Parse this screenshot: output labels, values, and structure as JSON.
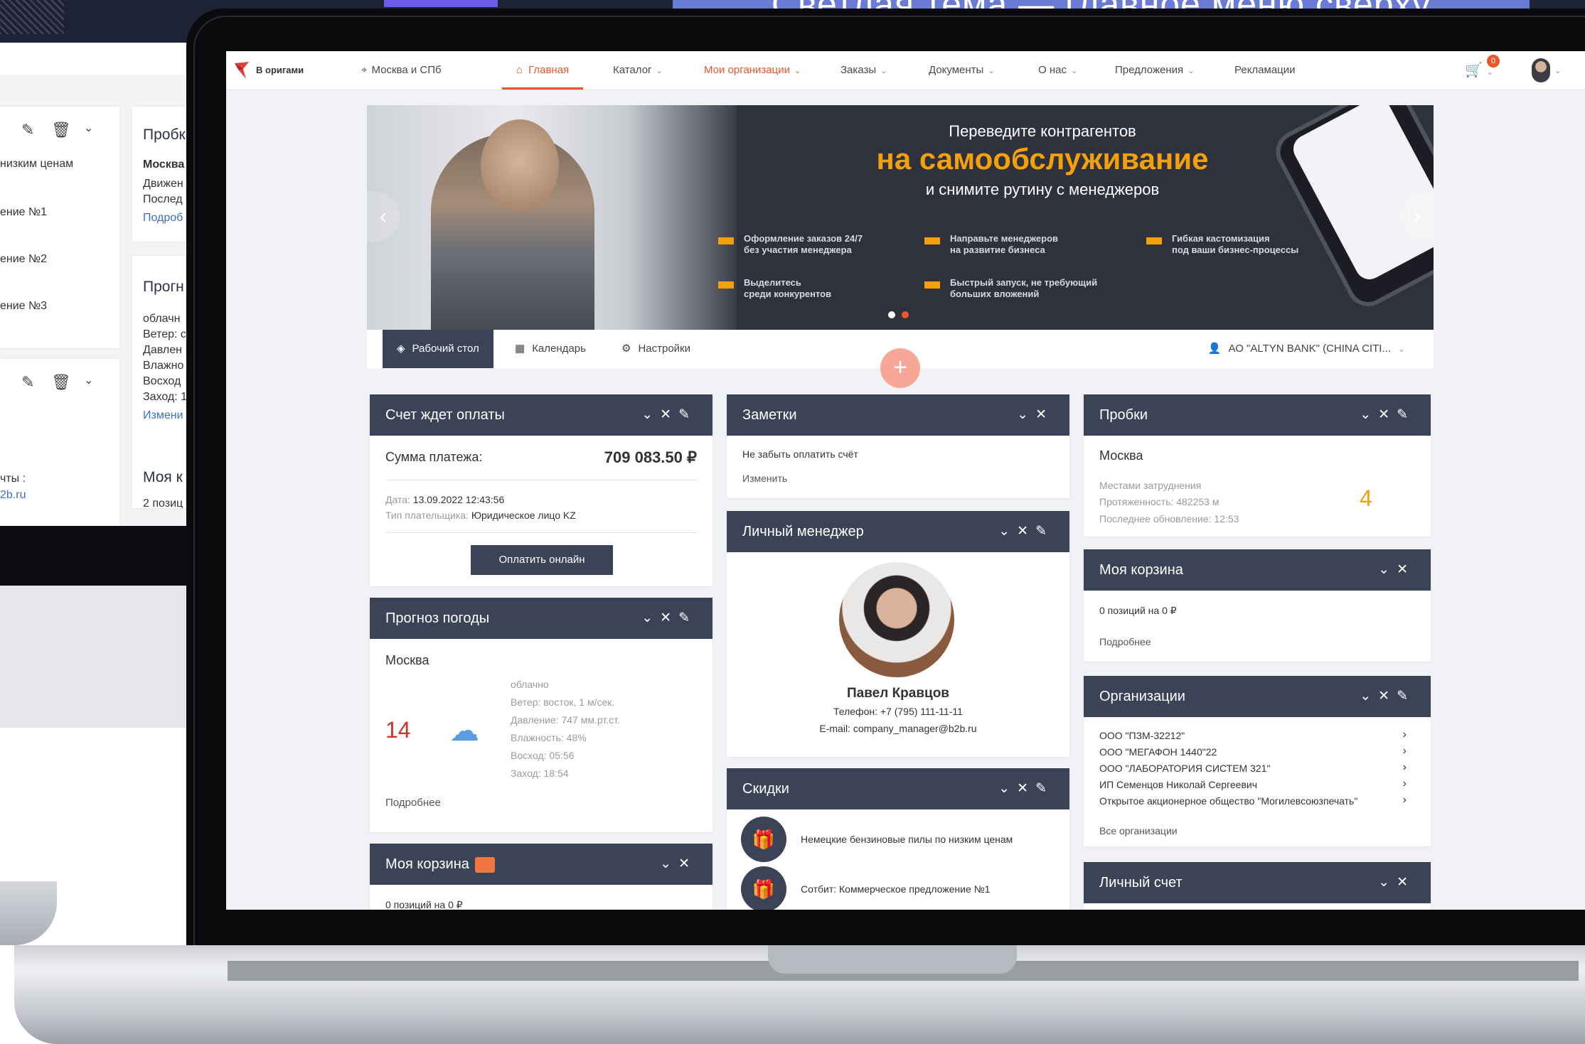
{
  "theme_banner": {
    "text": "Светлая тема — главное меню сверху"
  },
  "nav": {
    "logo": "В оригами",
    "location": "Москва и СПб",
    "items": [
      {
        "label": "Главная"
      },
      {
        "label": "Каталог"
      },
      {
        "label": "Мои организации"
      },
      {
        "label": "Заказы"
      },
      {
        "label": "Документы"
      },
      {
        "label": "О нас"
      },
      {
        "label": "Предложения"
      },
      {
        "label": "Рекламации"
      }
    ],
    "cart_count": "0"
  },
  "hero": {
    "line1": "Переведите контрагентов",
    "line2": "на самообслуживание",
    "line3": "и снимите рутину с менеджеров",
    "features": [
      "Оформление заказов 24/7\nбез участия менеджера",
      "Направьте менеджеров\nна развитие бизнеса",
      "Гибкая кастомизация\nпод ваши бизнес-процессы",
      "Выделитесь\nсреди конкурентов",
      "Быстрый запуск, не требующий\nбольших вложений"
    ]
  },
  "tabs": {
    "desktop": "Рабочий стол",
    "calendar": "Календарь",
    "settings": "Настройки",
    "organization": "АО \"ALTYN BANK\" (CHINA CITI..."
  },
  "invoice": {
    "title": "Счет ждет оплаты",
    "amount_label": "Сумма платежа:",
    "amount": "709 083.50 ₽",
    "date_label": "Дата:",
    "date": "13.09.2022 12:43:56",
    "payer_label": "Тип плательщика:",
    "payer": "Юридическое лицо KZ",
    "pay_button": "Оплатить онлайн"
  },
  "notes": {
    "title": "Заметки",
    "text": "Не забыть оплатить счёт",
    "edit": "Изменить"
  },
  "traffic": {
    "title": "Пробки",
    "city": "Москва",
    "status": "Местами затруднения",
    "length": "Протяженность: 482253 м",
    "updated": "Последнее обновление: 12:53",
    "score": "4"
  },
  "weather": {
    "title": "Прогноз погоды",
    "city": "Москва",
    "temp": "14",
    "details": [
      "облачно",
      "Ветер: восток, 1 м/сек.",
      "Давление: 747 мм.рт.ст.",
      "Влажность: 48%",
      "Восход: 05:56",
      "Заход: 18:54"
    ],
    "more": "Подробнее"
  },
  "manager": {
    "title": "Личный менеджер",
    "name": "Павел Кравцов",
    "phone": "Телефон: +7 (795) 111-11-11",
    "email": "E-mail: company_manager@b2b.ru"
  },
  "cart_right": {
    "title": "Моя корзина",
    "text": "0 позиций на 0 ₽",
    "more": "Подробнее"
  },
  "orgs": {
    "title": "Организации",
    "items": [
      "ООО \"ПЗМ-32212\"",
      "ООО \"МЕГАФОН 1440\"22",
      "ООО \"ЛАБОРАТОРИЯ СИСТЕМ 321\"",
      "ИП Семенцов Николай Сергеевич",
      "Открытое акционерное общество \"Могилевсоюзпечать\""
    ],
    "all": "Все организации"
  },
  "discounts": {
    "title": "Скидки",
    "items": [
      "Немецкие бензиновые пилы по низким ценам",
      "Сотбит: Коммерческое предложение №1"
    ]
  },
  "cart_left": {
    "title": "Моя корзина",
    "text": "0 позиций на 0 ₽"
  },
  "account": {
    "title": "Личный счет"
  },
  "ghost": {
    "lines": [
      "низким ценам",
      "ение №1",
      "ение №2",
      "ение №3",
      "чты :",
      "2b.ru"
    ],
    "traffic_title": "Пробк",
    "traffic_lines": [
      "Москва",
      "Движен",
      "Послед",
      "Подроб"
    ],
    "forecast_title": "Прогн",
    "forecast_lines": [
      "облачн",
      "Ветер: с",
      "Давлен",
      "Влажно",
      "Восход",
      "Заход: 1",
      "Измени"
    ],
    "cart_title": "Моя к",
    "cart_line": "2 позиц"
  }
}
